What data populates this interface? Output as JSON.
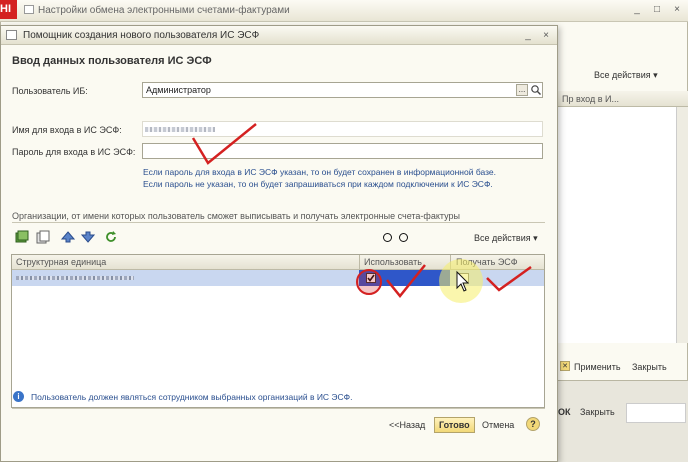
{
  "background_window": {
    "title": "Настройки обмена электронными счетами-фактурами",
    "logo_text": "НІ",
    "all_actions": "Все действия",
    "column_header": "Пр вход в И...",
    "apply": "Применить",
    "close": "Закрыть",
    "ok": "ОК",
    "close2": "Закрыть"
  },
  "dialog": {
    "title": "Помощник создания нового пользователя ИС ЭСФ",
    "heading": "Ввод данных пользователя ИС ЭСФ",
    "user_ib_label": "Пользователь ИБ:",
    "user_ib_value": "Администратор",
    "select_btn": "...",
    "login_label": "Имя для входа в ИС ЭСФ:",
    "password_label": "Пароль для входа в ИС ЭСФ:",
    "hint_line1": "Если пароль для входа в ИС ЭСФ указан, то он будет сохранен в информационной базе.",
    "hint_line2": "Если пароль не указан, то он будет запрашиваться при каждом подключении к ИС ЭСФ.",
    "orgs_label": "Организации, от имени которых пользователь сможет выписывать и получать электронные счета-фактуры",
    "all_actions": "Все действия",
    "table": {
      "columns": [
        "Структурная единица",
        "Использовать",
        "Получать ЭСФ"
      ],
      "rows": [
        {
          "use": true,
          "receive": false
        }
      ]
    },
    "info": "Пользователь должен являться сотрудником выбранных организаций в ИС ЭСФ.",
    "back": "<<Назад",
    "done": "Готово",
    "cancel": "Отмена",
    "help": "?"
  },
  "colors": {
    "accent_red": "#d42121",
    "selection_blue": "#c9d7f0",
    "hint_blue": "#2a4f8f",
    "highlight_yellow": "#f5ef6a"
  }
}
